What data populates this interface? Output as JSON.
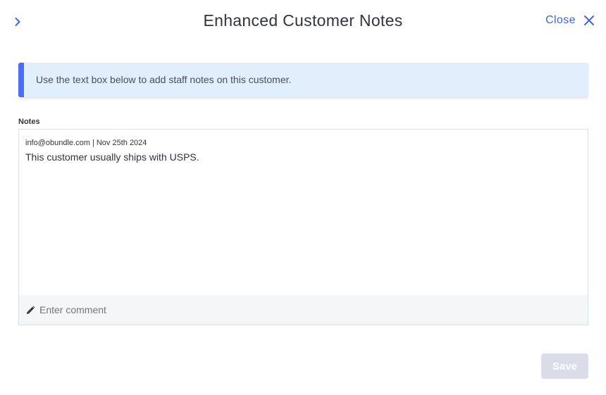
{
  "header": {
    "title": "Enhanced Customer Notes",
    "close_label": "Close",
    "expand_icon": "chevron-right-icon",
    "close_icon": "close-icon"
  },
  "info_banner": {
    "text": "Use the text box below to add staff notes on this customer."
  },
  "notes": {
    "label": "Notes",
    "entries": [
      {
        "meta": "info@obundle.com | Nov 25th 2024",
        "text": "This customer usually ships with USPS."
      }
    ],
    "comment_placeholder": "Enter comment",
    "comment_icon": "pencil-icon"
  },
  "footer": {
    "save_label": "Save"
  },
  "colors": {
    "accent": "#3c64f4",
    "banner_bg": "#e1effd",
    "banner_border": "#4c6ef5",
    "disabled_button": "#d9dce9"
  }
}
